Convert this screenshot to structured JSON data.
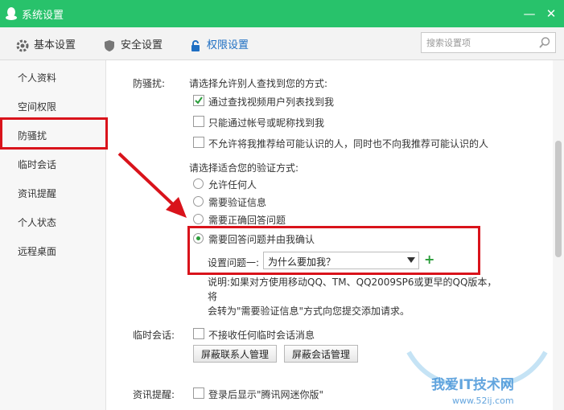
{
  "window": {
    "title": "系统设置",
    "accent": "#28c26b",
    "minimize": "—",
    "close": "✕"
  },
  "tabs": [
    {
      "label": "基本设置",
      "icon": "gear-icon"
    },
    {
      "label": "安全设置",
      "icon": "shield-icon"
    },
    {
      "label": "权限设置",
      "icon": "lock-icon",
      "active": true
    }
  ],
  "search": {
    "placeholder": "搜索设置项",
    "value": ""
  },
  "sidebar": {
    "items": [
      {
        "label": "个人资料"
      },
      {
        "label": "空间权限"
      },
      {
        "label": "防骚扰",
        "selected": true
      },
      {
        "label": "临时会话"
      },
      {
        "label": "资讯提醒"
      },
      {
        "label": "个人状态"
      },
      {
        "label": "远程桌面"
      }
    ]
  },
  "anti_harass": {
    "section_label": "防骚扰:",
    "find_prompt": "请选择允许别人查找到您的方式:",
    "find_options": [
      {
        "label": "通过查找视频用户列表找到我",
        "checked": true
      },
      {
        "label": "只能通过帐号或昵称找到我",
        "checked": false
      },
      {
        "label": "不允许将我推荐给可能认识的人，同时也不向我推荐可能认识的人",
        "checked": false
      }
    ],
    "verify_prompt": "请选择适合您的验证方式:",
    "verify_options": [
      {
        "label": "允许任何人",
        "selected": false
      },
      {
        "label": "需要验证信息",
        "selected": false
      },
      {
        "label": "需要正确回答问题",
        "selected": false
      },
      {
        "label": "需要回答问题并由我确认",
        "selected": true
      }
    ],
    "question_label": "设置问题一:",
    "question_value": "为什么要加我？",
    "add_symbol": "+",
    "note_line1": "说明:如果对方使用移动QQ、TM、QQ2009SP6或更早的QQ版本，将",
    "note_line2": "会转为\"需要验证信息\"方式向您提交添加请求。"
  },
  "temp_session": {
    "section_label": "临时会话:",
    "option": {
      "label": "不接收任何临时会话消息",
      "checked": false
    },
    "buttons": [
      "屏蔽联系人管理",
      "屏蔽会话管理"
    ]
  },
  "news": {
    "section_label": "资讯提醒:",
    "option": {
      "label": "登录后显示\"腾讯网迷你版\"",
      "checked": false
    }
  },
  "watermark": {
    "title": "我爱IT技术网",
    "url": "www.52ij.com"
  },
  "highlight_color": "#d9131b"
}
